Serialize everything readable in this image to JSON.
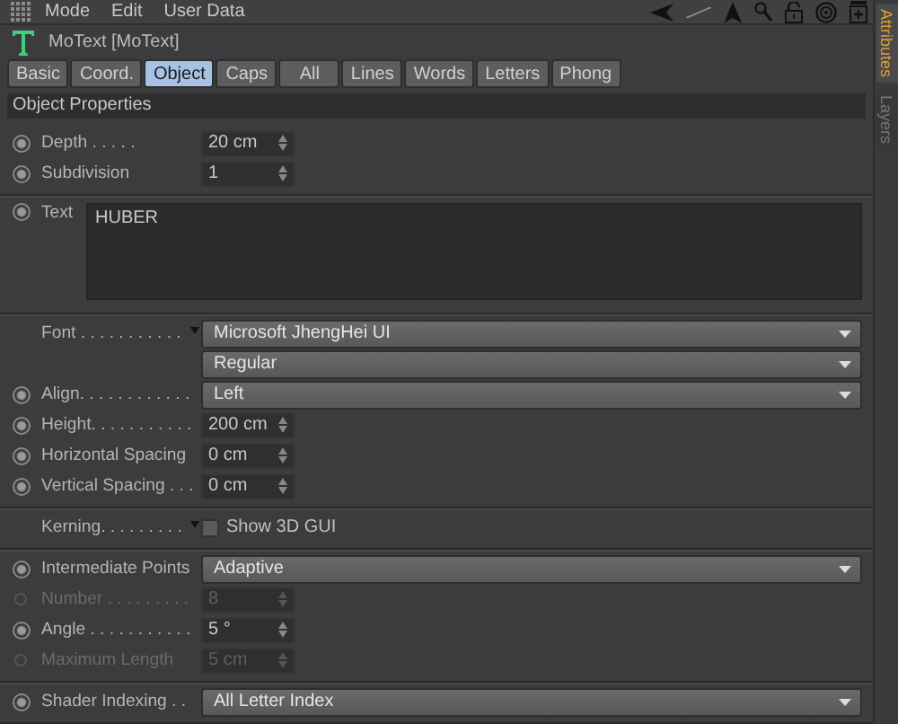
{
  "menu": [
    "Mode",
    "Edit",
    "User Data"
  ],
  "title": "MoText [MoText]",
  "tabs": [
    {
      "label": "Basic",
      "selected": false
    },
    {
      "label": "Coord.",
      "selected": false
    },
    {
      "label": "Object",
      "selected": true
    },
    {
      "label": "Caps",
      "selected": false
    },
    {
      "label": "All",
      "selected": false
    },
    {
      "label": "Lines",
      "selected": false
    },
    {
      "label": "Words",
      "selected": false
    },
    {
      "label": "Letters",
      "selected": false
    },
    {
      "label": "Phong",
      "selected": false
    }
  ],
  "section": "Object Properties",
  "groups": [
    [
      {
        "kind": "number",
        "label": "Depth . . . . .",
        "value": "20 cm",
        "animatable": true,
        "disabled": false
      },
      {
        "kind": "number",
        "label": "Subdivision",
        "value": "1",
        "animatable": true,
        "disabled": false
      }
    ],
    [
      {
        "kind": "textarea",
        "label": "Text",
        "value": "HUBER",
        "animatable": true,
        "disabled": false
      }
    ],
    [
      {
        "kind": "dropdown",
        "label": "Font . . . . . . . . . . .",
        "value": "Microsoft JhengHei UI",
        "animatable": false,
        "expandable": true,
        "disabled": false
      },
      {
        "kind": "dropdown",
        "value": "Regular",
        "animatable": false,
        "disabled": false
      },
      {
        "kind": "dropdown",
        "label": "Align. . . . . . . . . . . .",
        "value": "Left",
        "animatable": true,
        "disabled": false
      },
      {
        "kind": "number",
        "label": "Height. . . . . . . . . . .",
        "value": "200 cm",
        "animatable": true,
        "disabled": false
      },
      {
        "kind": "number",
        "label": "Horizontal Spacing",
        "value": "0 cm",
        "animatable": true,
        "disabled": false
      },
      {
        "kind": "number",
        "label": "Vertical Spacing . . .",
        "value": "0 cm",
        "animatable": true,
        "disabled": false
      }
    ],
    [
      {
        "kind": "checkbox",
        "label": "Kerning. . . . . . . . .",
        "value": "Show 3D GUI",
        "checked": false,
        "animatable": false,
        "expandable": true,
        "disabled": false
      }
    ],
    [
      {
        "kind": "dropdown",
        "label": "Intermediate Points",
        "value": "Adaptive",
        "animatable": true,
        "disabled": false
      },
      {
        "kind": "number",
        "label": "Number . . . . . . . . .",
        "value": "8",
        "animatable": true,
        "disabled": true
      },
      {
        "kind": "number",
        "label": "Angle . . . . . . . . . . .",
        "value": "5 °",
        "animatable": true,
        "disabled": false
      },
      {
        "kind": "number",
        "label": "Maximum Length",
        "value": "5 cm",
        "animatable": true,
        "disabled": true
      }
    ],
    [
      {
        "kind": "dropdown",
        "label": "Shader Indexing . .",
        "value": "All Letter Index",
        "animatable": true,
        "disabled": false
      }
    ]
  ],
  "side_tabs": [
    {
      "label": "Attributes",
      "selected": true
    },
    {
      "label": "Layers",
      "selected": false
    }
  ]
}
